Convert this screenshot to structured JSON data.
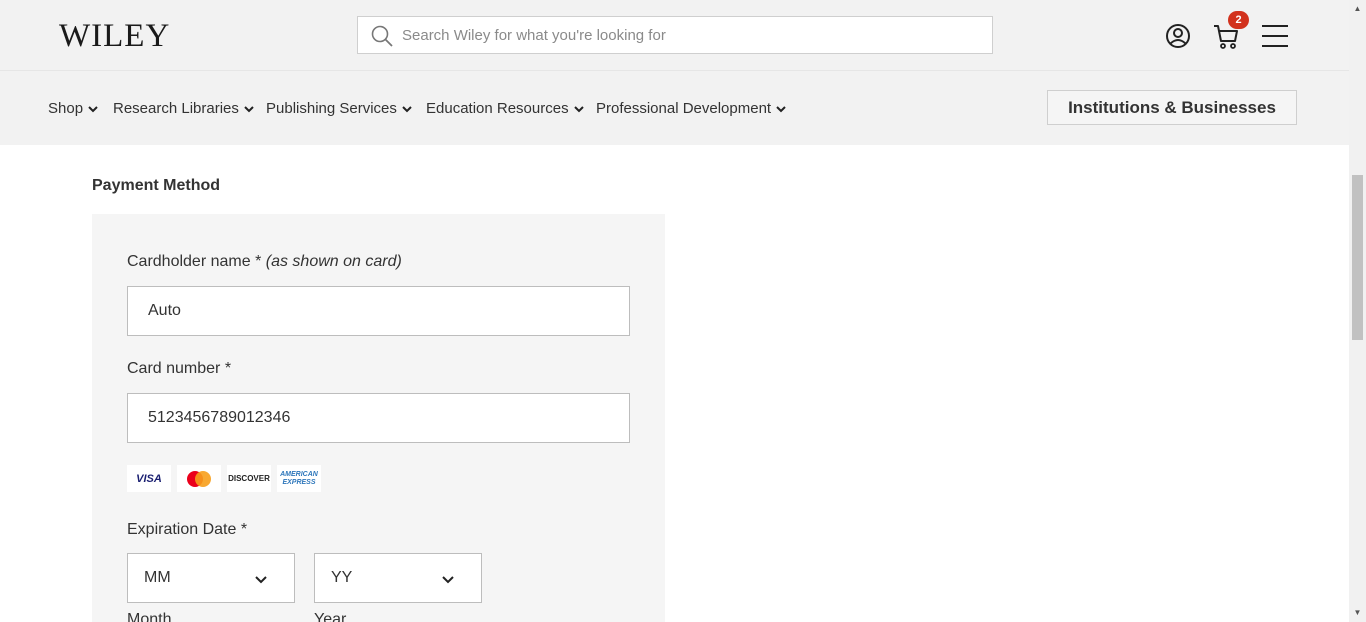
{
  "header": {
    "logo": "WILEY",
    "search_placeholder": "Search Wiley for what you're looking for",
    "cart_count": "2",
    "icons": [
      "search-icon",
      "user-icon",
      "cart-icon",
      "menu-icon"
    ]
  },
  "nav": {
    "items": [
      {
        "label": "Shop"
      },
      {
        "label": "Research Libraries"
      },
      {
        "label": "Publishing Services"
      },
      {
        "label": "Education Resources"
      },
      {
        "label": "Professional Development"
      }
    ],
    "cta": "Institutions & Businesses"
  },
  "payment": {
    "section_title": "Payment Method",
    "cardholder": {
      "label": "Cardholder name *",
      "hint": "(as shown on card)",
      "value": "Auto"
    },
    "card_number": {
      "label": "Card number *",
      "value": "5123456789012346"
    },
    "card_logos": [
      "VISA",
      "mastercard",
      "DISCOVER",
      "AMERICAN EXPRESS"
    ],
    "expiration": {
      "label": "Expiration Date *",
      "month_value": "MM",
      "year_value": "YY",
      "month_label": "Month",
      "year_label": "Year"
    }
  },
  "colors": {
    "header_bg": "#f2f2f2",
    "badge": "#d2321d",
    "panel_bg": "#f5f5f5",
    "heading_blue": "#0a3d62"
  }
}
